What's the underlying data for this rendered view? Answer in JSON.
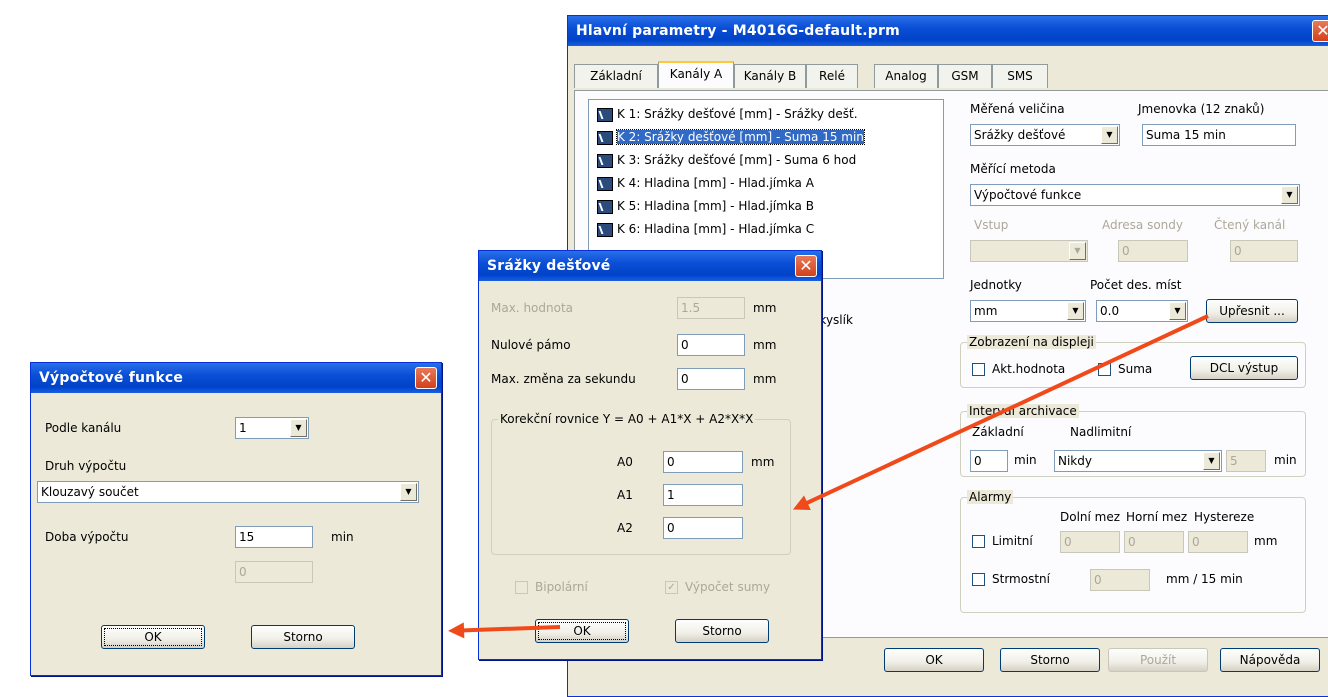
{
  "main_window": {
    "title": "Hlavní parametry - M4016G-default.prm",
    "tabs": [
      "Základní",
      "Kanály A",
      "Kanály B",
      "Relé",
      "Analog",
      "GSM",
      "SMS"
    ],
    "channels": [
      "K 1: Srážky dešťové [mm] - Srážky dešť.",
      "K 2: Srážky dešťové [mm] - Suma 15 min",
      "K 3: Srážky dešťové [mm] - Suma 6 hod",
      "K 4: Hladina [mm] - Hlad.jímka A",
      "K 5: Hladina [mm] - Hlad.jímka B",
      "K 6: Hladina [mm] - Hlad.jímka C"
    ],
    "channel_tail": "p.kyslík",
    "measured_quantity_label": "Měřená veličina",
    "measured_quantity_value": "Srážky dešťové",
    "name_label": "Jmenovka  (12 znaků)",
    "name_value": "Suma 15 min",
    "method_label": "Měřící metoda",
    "method_value": "Výpočtové funkce",
    "input_label": "Vstup",
    "probe_address_label": "Adresa sondy",
    "read_channel_label": "Čtený kanál",
    "probe_address_value": "0",
    "read_channel_value": "0",
    "units_label": "Jednotky",
    "units_value": "mm",
    "decimals_label": "Počet des. míst",
    "decimals_value": "0.0",
    "refine_button": "Upřesnit ...",
    "display_group": "Zobrazení na displeji",
    "akt_hodnota": "Akt.hodnota",
    "suma": "Suma",
    "dcl_button": "DCL výstup",
    "archive_group": "Interval archivace",
    "archive_basic_label": "Základní",
    "archive_over_label": "Nadlimitní",
    "archive_basic_value": "0",
    "archive_unit": "min",
    "archive_over_value": "Nikdy",
    "archive_over_num": "5",
    "archive_unit2": "min",
    "alarm_group": "Alarmy",
    "lower_label": "Dolní mez",
    "upper_label": "Horní mez",
    "hyst_label": "Hystereze",
    "limit_label": "Limitní",
    "limit_lower": "0",
    "limit_upper": "0",
    "limit_hyst": "0",
    "limit_unit": "mm",
    "slope_label": "Strmostní",
    "slope_value": "0",
    "slope_unit": "mm / 15 min",
    "ok": "OK",
    "cancel": "Storno",
    "apply": "Použít",
    "help": "Nápověda"
  },
  "srazky_dialog": {
    "title": "Srážky dešťové",
    "max_value_label": "Max. hodnota",
    "max_value": "1.5",
    "max_unit": "mm",
    "zero_band_label": "Nulové pámo",
    "zero_band": "0",
    "zero_unit": "mm",
    "max_change_label": "Max. změna za sekundu",
    "max_change": "0",
    "change_unit": "mm",
    "corr_group": "Korekční rovnice Y = A0 + A1*X + A2*X*X",
    "a0_label": "A0",
    "a0": "0",
    "a0_unit": "mm",
    "a1_label": "A1",
    "a1": "1",
    "a2_label": "A2",
    "a2": "0",
    "bipolar": "Bipolární",
    "sum_calc": "Výpočet sumy",
    "ok": "OK",
    "cancel": "Storno"
  },
  "vypoctove_dialog": {
    "title": "Výpočtové funkce",
    "by_channel_label": "Podle kanálu",
    "by_channel_value": "1",
    "calc_type_label": "Druh výpočtu",
    "calc_type_value": "Klouzavý součet",
    "calc_time_label": "Doba výpočtu",
    "calc_time_value": "15",
    "calc_time_unit": "min",
    "extra_value": "0",
    "ok": "OK",
    "cancel": "Storno"
  },
  "colors": {
    "accent_arrow": "#f04a1a",
    "titlebar": "#0a4fd6",
    "selection": "#316ac5"
  }
}
